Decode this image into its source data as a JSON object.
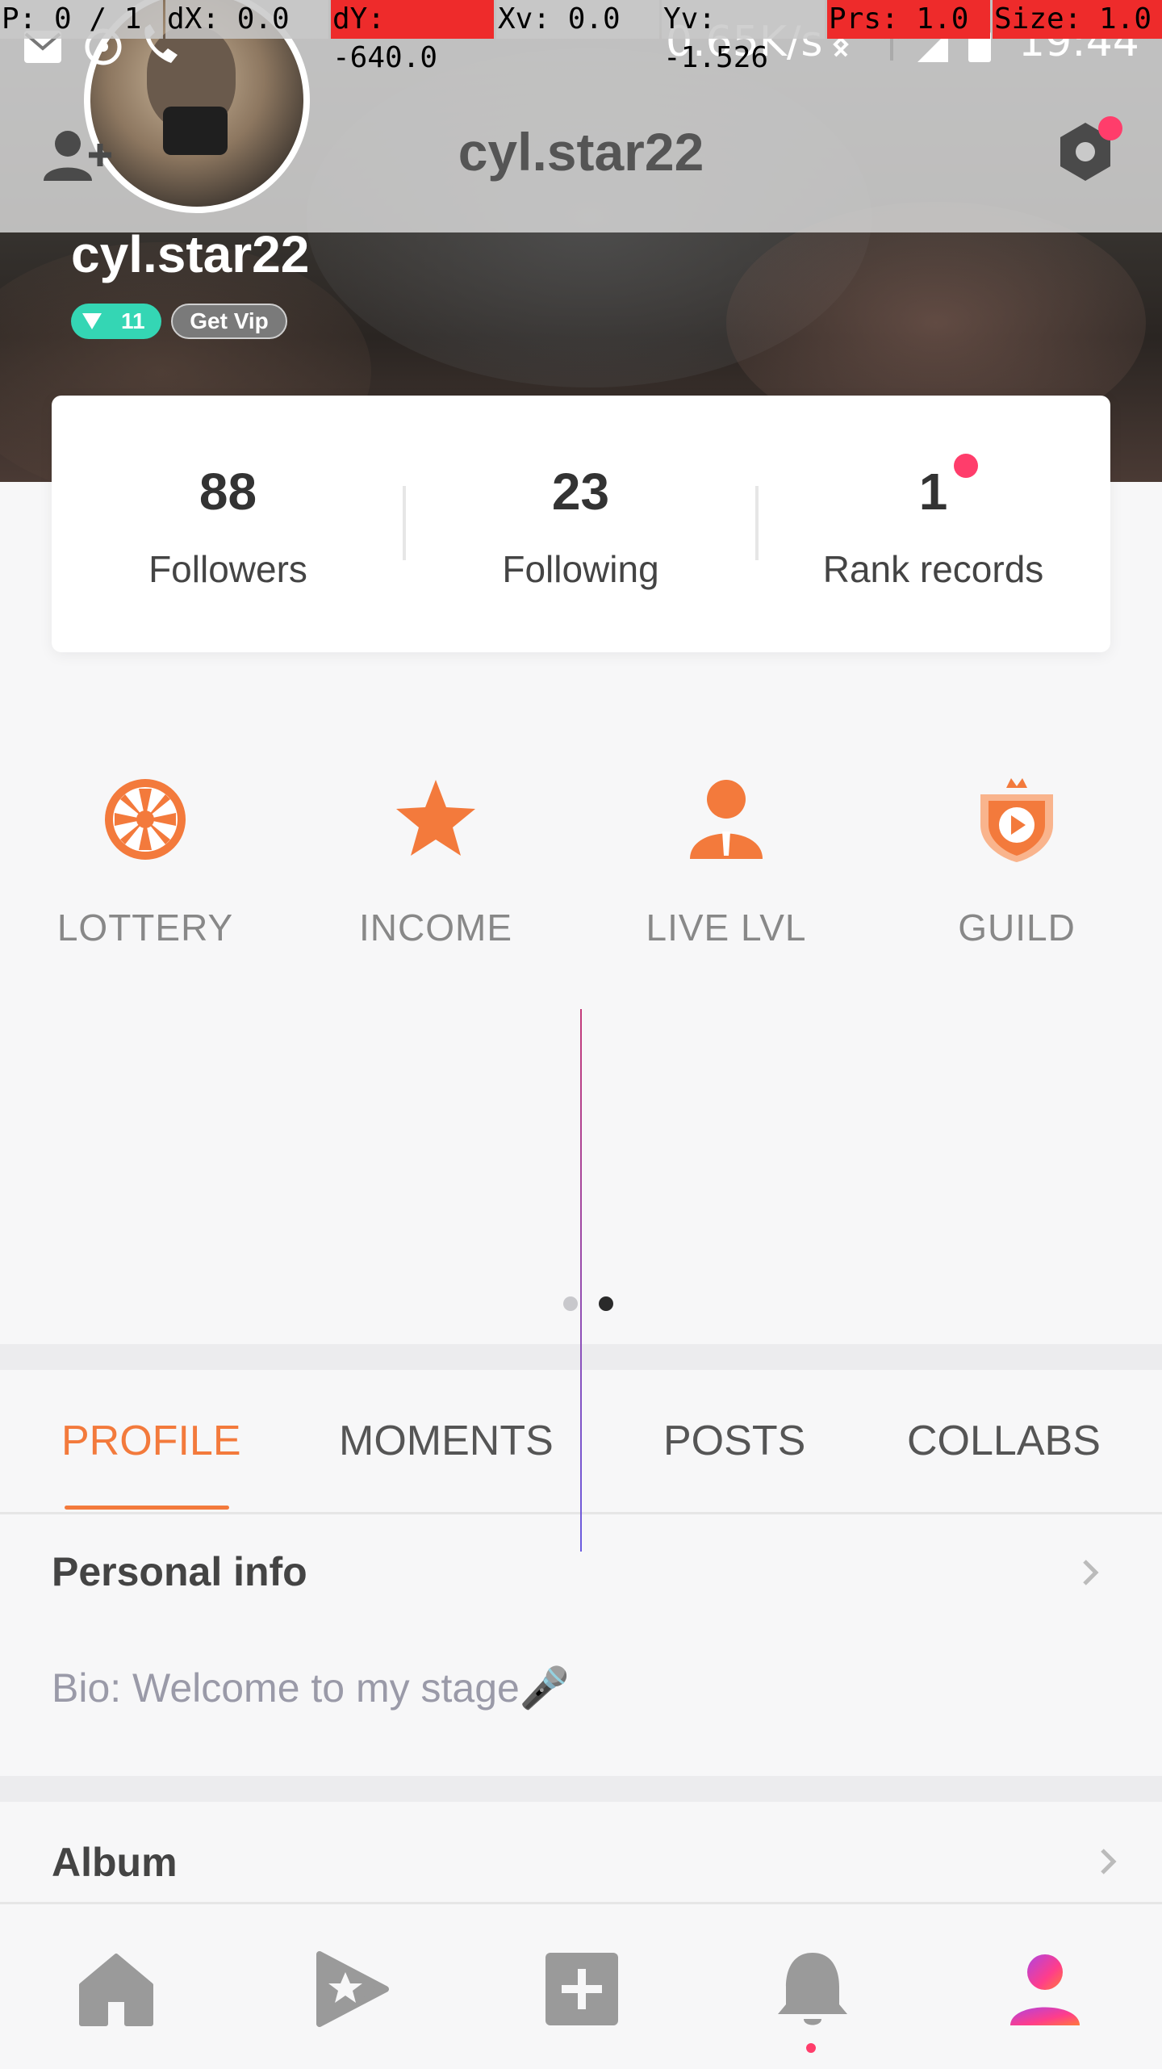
{
  "debug_overlay": {
    "pointer": "P: 0 / 1",
    "dx": "dX: 0.0",
    "dy": "dY: -640.0",
    "xv": "Xv: 0.0",
    "yv": "Yv: -1.526",
    "prs": "Prs: 1.0",
    "size": "Size: 1.0"
  },
  "status_bar": {
    "network_speed": "0.65K/s",
    "time": "19:44"
  },
  "header": {
    "title": "cyl.star22",
    "username": "cyl.star22",
    "level": "11",
    "vip_label": "Get Vip",
    "settings_has_notification": true
  },
  "stats": [
    {
      "value": "88",
      "label": "Followers"
    },
    {
      "value": "23",
      "label": "Following"
    },
    {
      "value": "1",
      "label": "Rank records",
      "has_notification": true
    }
  ],
  "features": [
    {
      "label": "LOTTERY",
      "icon": "lottery-wheel-icon"
    },
    {
      "label": "INCOME",
      "icon": "star-icon"
    },
    {
      "label": "LIVE LVL",
      "icon": "person-badge-icon"
    },
    {
      "label": "GUILD",
      "icon": "guild-shield-icon"
    }
  ],
  "pager": {
    "count": 2,
    "active_index": 1
  },
  "tabs": [
    {
      "label": "PROFILE",
      "active": true
    },
    {
      "label": "MOMENTS",
      "active": false
    },
    {
      "label": "POSTS",
      "active": false
    },
    {
      "label": "COLLABS",
      "active": false
    }
  ],
  "profile": {
    "personal_info_title": "Personal info",
    "bio": "Bio: Welcome to my stage🎤",
    "album_title": "Album"
  },
  "bottom_nav": [
    {
      "icon": "home-icon",
      "active": false
    },
    {
      "icon": "play-star-icon",
      "active": false
    },
    {
      "icon": "add-icon",
      "active": false
    },
    {
      "icon": "bell-icon",
      "active": false,
      "has_notification": true
    },
    {
      "icon": "profile-icon",
      "active": true
    }
  ],
  "colors": {
    "accent": "#f37a3c",
    "notification": "#ff3d6b",
    "level_badge": "#34d6b4",
    "inactive_icon": "#999999"
  }
}
